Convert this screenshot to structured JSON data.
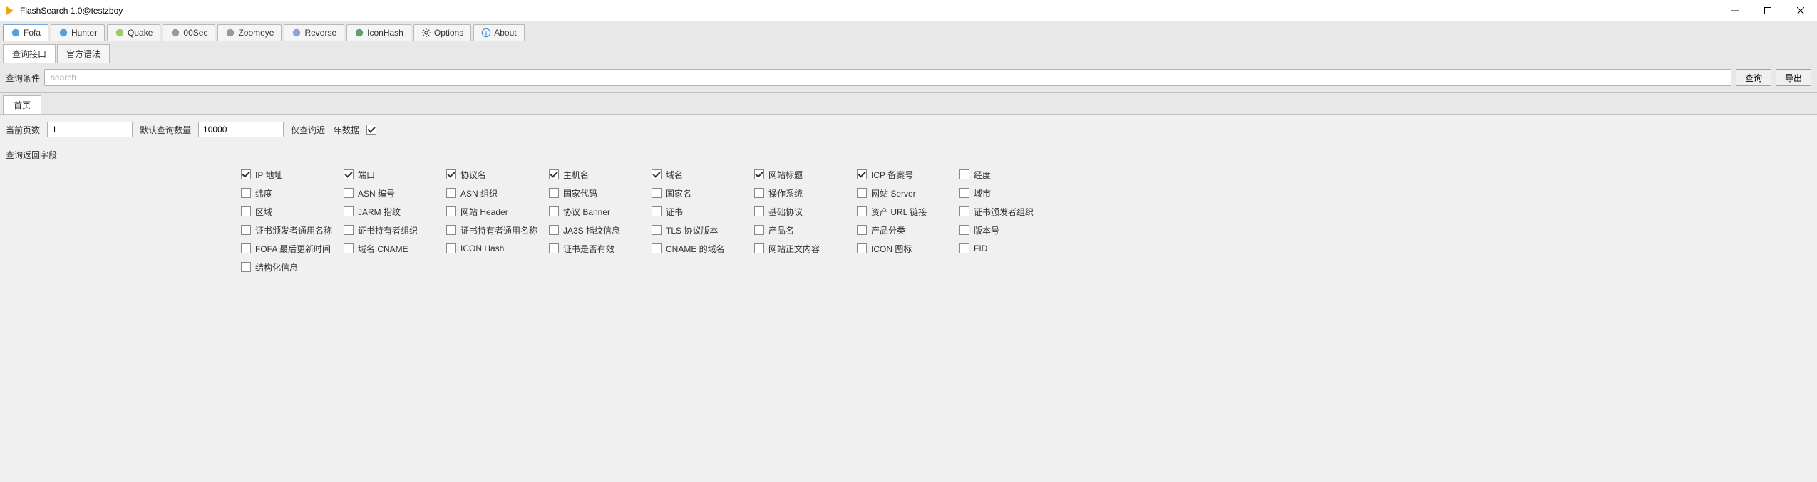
{
  "window": {
    "title": "FlashSearch 1.0@testzboy"
  },
  "main_tabs": [
    {
      "label": "Fofa",
      "icon_color": "#3b8fd6",
      "active": true
    },
    {
      "label": "Hunter",
      "icon_color": "#3b8fd6"
    },
    {
      "label": "Quake",
      "icon_color": "#8bc34a"
    },
    {
      "label": "00Sec",
      "icon_color": "#888"
    },
    {
      "label": "Zoomeye",
      "icon_color": "#888"
    },
    {
      "label": "Reverse",
      "icon_color": "#7b8fd6"
    },
    {
      "label": "IconHash",
      "icon_color": "#4a8c5a"
    },
    {
      "label": "Options",
      "icon_color": "#333",
      "gear": true
    },
    {
      "label": "About",
      "icon_color": "#3b8fd6",
      "info": true
    }
  ],
  "sub_tabs": [
    {
      "label": "查询接口",
      "active": true
    },
    {
      "label": "官方语法"
    }
  ],
  "search": {
    "label": "查询条件",
    "placeholder": "search",
    "value": "",
    "query_btn": "查询",
    "export_btn": "导出"
  },
  "result_tab": "首页",
  "params": {
    "page_label": "当前页数",
    "page_value": "1",
    "count_label": "默认查询数量",
    "count_value": "10000",
    "year_label": "仅查询近一年数据",
    "year_checked": true
  },
  "fields_label": "查询返回字段",
  "fields": [
    {
      "label": "IP 地址",
      "checked": true
    },
    {
      "label": "端口",
      "checked": true
    },
    {
      "label": "协议名",
      "checked": true
    },
    {
      "label": "主机名",
      "checked": true
    },
    {
      "label": "域名",
      "checked": true
    },
    {
      "label": "网站标题",
      "checked": true
    },
    {
      "label": "ICP 备案号",
      "checked": true
    },
    {
      "label": "经度",
      "checked": false
    },
    {
      "label": "纬度",
      "checked": false
    },
    {
      "label": "ASN 编号",
      "checked": false
    },
    {
      "label": "ASN 组织",
      "checked": false
    },
    {
      "label": "国家代码",
      "checked": false
    },
    {
      "label": "国家名",
      "checked": false
    },
    {
      "label": "操作系统",
      "checked": false
    },
    {
      "label": "网站 Server",
      "checked": false
    },
    {
      "label": "城市",
      "checked": false
    },
    {
      "label": "区域",
      "checked": false
    },
    {
      "label": "JARM 指纹",
      "checked": false
    },
    {
      "label": "网站 Header",
      "checked": false
    },
    {
      "label": "协议 Banner",
      "checked": false
    },
    {
      "label": "证书",
      "checked": false
    },
    {
      "label": "基础协议",
      "checked": false
    },
    {
      "label": "资产 URL 链接",
      "checked": false
    },
    {
      "label": "证书颁发者组织",
      "checked": false
    },
    {
      "label": "证书颁发者通用名称",
      "checked": false
    },
    {
      "label": "证书持有者组织",
      "checked": false
    },
    {
      "label": "证书持有者通用名称",
      "checked": false
    },
    {
      "label": "JA3S 指纹信息",
      "checked": false
    },
    {
      "label": "TLS 协议版本",
      "checked": false
    },
    {
      "label": "产品名",
      "checked": false
    },
    {
      "label": "产品分类",
      "checked": false
    },
    {
      "label": "版本号",
      "checked": false
    },
    {
      "label": "FOFA 最后更新时间",
      "checked": false
    },
    {
      "label": "域名 CNAME",
      "checked": false
    },
    {
      "label": "ICON Hash",
      "checked": false
    },
    {
      "label": "证书是否有效",
      "checked": false
    },
    {
      "label": "CNAME 的域名",
      "checked": false
    },
    {
      "label": "网站正文内容",
      "checked": false
    },
    {
      "label": "ICON 图标",
      "checked": false
    },
    {
      "label": "FID",
      "checked": false
    },
    {
      "label": "结构化信息",
      "checked": false
    }
  ]
}
